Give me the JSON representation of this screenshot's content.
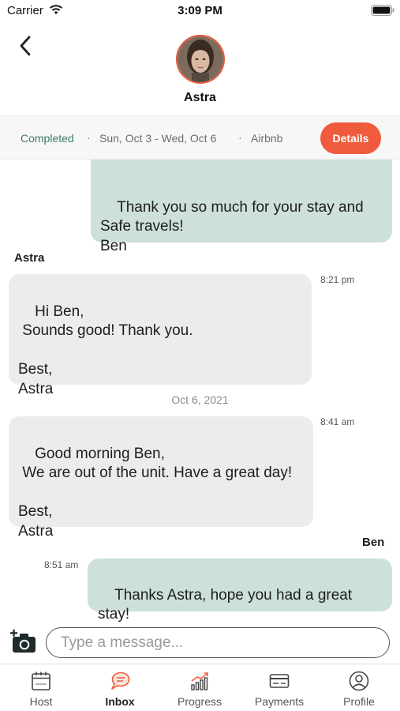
{
  "status_bar": {
    "carrier": "Carrier",
    "time": "3:09 PM"
  },
  "header": {
    "contact_name": "Astra"
  },
  "booking": {
    "status": "Completed",
    "dates": "Sun, Oct 3 - Wed, Oct 6",
    "platform": "Airbnb",
    "details_label": "Details",
    "separator": "·"
  },
  "messages": [
    {
      "direction": "outgoing",
      "text": "Thank you so much for your stay and\nSafe travels!\nBen"
    },
    {
      "direction": "incoming",
      "sender": "Astra",
      "text": "Hi Ben,\n Sounds good! Thank you.\n\nBest,\nAstra",
      "time": "8:21 pm"
    },
    {
      "direction": "incoming",
      "text": "Good morning Ben,\n We are out of the unit. Have a great day!\n\nBest,\nAstra",
      "time": "8:41 am"
    },
    {
      "direction": "outgoing",
      "sender": "Ben",
      "text": "Thanks Astra, hope you had a great\nstay!",
      "time": "8:51 am"
    }
  ],
  "date_divider": "Oct 6, 2021",
  "composer": {
    "placeholder": "Type a message..."
  },
  "tabs": [
    {
      "label": "Host",
      "icon": "calendar-icon",
      "active": false
    },
    {
      "label": "Inbox",
      "icon": "chat-icon",
      "active": true
    },
    {
      "label": "Progress",
      "icon": "progress-chart-icon",
      "active": false
    },
    {
      "label": "Payments",
      "icon": "payment-card-icon",
      "active": false
    },
    {
      "label": "Profile",
      "icon": "profile-icon",
      "active": false
    }
  ],
  "colors": {
    "accent": "#ef5b3c",
    "status_green": "#3e7a68",
    "outgoing_bubble": "#cde0dc",
    "incoming_bubble": "#ececef"
  }
}
